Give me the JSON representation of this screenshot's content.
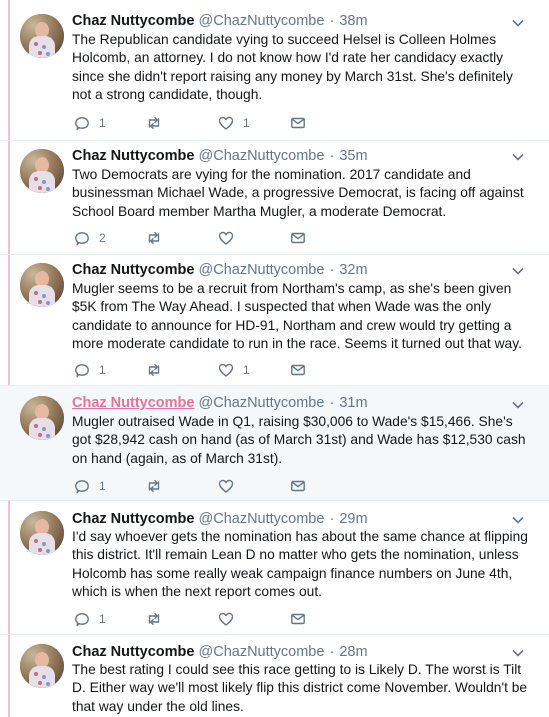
{
  "thread": {
    "accent_color": "#e8739a",
    "line_color": "#f4c0cf",
    "tweets": [
      {
        "display_name": "Chaz Nuttycombe",
        "handle": "@ChazNuttycombe",
        "separator": "·",
        "time": "38m",
        "text": "The Republican candidate vying to succeed Helsel is Colleen Holmes Holcomb, an attorney. I do not know how I'd rate her candidacy exactly since she didn't report raising any money by March 31st. She's definitely not a strong candidate, though.",
        "reply_count": "1",
        "retweet_count": "",
        "like_count": "1",
        "highlighted": false
      },
      {
        "display_name": "Chaz Nuttycombe",
        "handle": "@ChazNuttycombe",
        "separator": "·",
        "time": "35m",
        "text": "Two Democrats are vying for the nomination. 2017 candidate and businessman Michael Wade, a progressive Democrat, is facing off against School Board member Martha Mugler, a moderate Democrat.",
        "reply_count": "2",
        "retweet_count": "",
        "like_count": "",
        "highlighted": false
      },
      {
        "display_name": "Chaz Nuttycombe",
        "handle": "@ChazNuttycombe",
        "separator": "·",
        "time": "32m",
        "text": "Mugler seems to be a recruit from Northam's camp, as she's been given $5K from The Way Ahead. I suspected that when Wade was the only candidate to announce for HD-91, Northam and crew would try getting a more moderate candidate to run in the race. Seems it turned out that way.",
        "reply_count": "1",
        "retweet_count": "",
        "like_count": "1",
        "highlighted": false
      },
      {
        "display_name": "Chaz Nuttycombe",
        "handle": "@ChazNuttycombe",
        "separator": "·",
        "time": "31m",
        "text": "Mugler outraised Wade in Q1, raising $30,006 to Wade's $15,466. She's got $28,942 cash on hand (as of March 31st) and Wade has $12,530 cash on hand (again, as of March 31st).",
        "reply_count": "1",
        "retweet_count": "",
        "like_count": "",
        "highlighted": true
      },
      {
        "display_name": "Chaz Nuttycombe",
        "handle": "@ChazNuttycombe",
        "separator": "·",
        "time": "29m",
        "text": "I'd say whoever gets the nomination has about the same chance at flipping this district. It'll remain Lean D no matter who gets the nomination, unless Holcomb has some really weak campaign finance numbers on June 4th, which is when the next report comes out.",
        "reply_count": "1",
        "retweet_count": "",
        "like_count": "",
        "highlighted": false
      },
      {
        "display_name": "Chaz Nuttycombe",
        "handle": "@ChazNuttycombe",
        "separator": "·",
        "time": "28m",
        "text": "The best rating I could see this race getting to is Likely D. The worst is Tilt D. Either way we'll most likely flip this district come November. Wouldn't be that way under the old lines.",
        "reply_count": "",
        "retweet_count": "",
        "like_count": "",
        "highlighted": false
      }
    ]
  }
}
